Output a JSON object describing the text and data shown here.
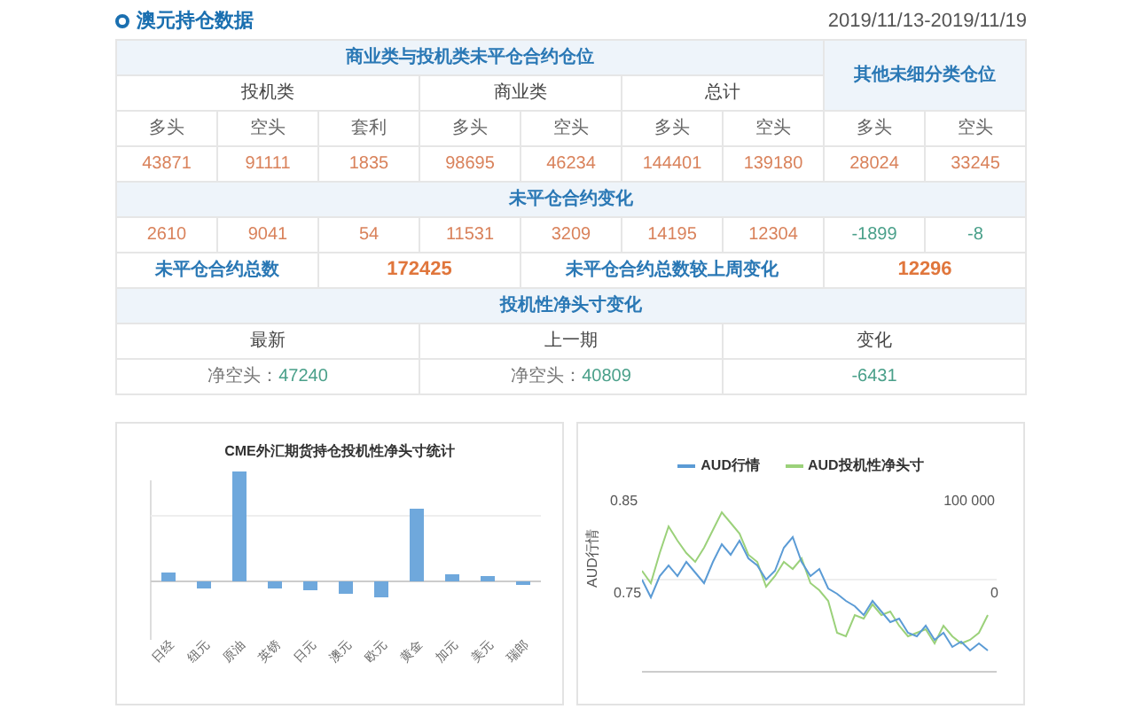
{
  "title": "澳元持仓数据",
  "date_range": "2019/11/13-2019/11/19",
  "table": {
    "group_header": "商业类与投机类未平仓合约仓位",
    "other_header": "其他未细分类仓位",
    "subgroups": [
      "投机类",
      "商业类",
      "总计"
    ],
    "position_headers": [
      "多头",
      "空头",
      "套利",
      "多头",
      "空头",
      "多头",
      "空头",
      "多头",
      "空头"
    ],
    "positions": [
      "43871",
      "91111",
      "1835",
      "98695",
      "46234",
      "144401",
      "139180",
      "28024",
      "33245"
    ],
    "change_header": "未平仓合约变化",
    "changes": [
      {
        "value": "2610",
        "color": "#d9825b"
      },
      {
        "value": "9041",
        "color": "#d9825b"
      },
      {
        "value": "54",
        "color": "#d9825b"
      },
      {
        "value": "11531",
        "color": "#d9825b"
      },
      {
        "value": "3209",
        "color": "#d9825b"
      },
      {
        "value": "14195",
        "color": "#d9825b"
      },
      {
        "value": "12304",
        "color": "#d9825b"
      },
      {
        "value": "-1899",
        "color": "#4aa08a"
      },
      {
        "value": "-8",
        "color": "#4aa08a"
      }
    ],
    "total_label": "未平仓合约总数",
    "total_value": "172425",
    "total_change_label": "未平仓合约总数较上周变化",
    "total_change_value": "12296",
    "net_header": "投机性净头寸变化",
    "net_columns": [
      "最新",
      "上一期",
      "变化"
    ],
    "net_values": [
      {
        "label": "净空头：",
        "value": "47240"
      },
      {
        "label": "净空头：",
        "value": "40809"
      },
      {
        "value": "-6431"
      }
    ]
  },
  "bar_chart": {
    "title": "CME外汇期货持仓投机性净头寸统计",
    "categories": [
      "日经",
      "纽元",
      "原油",
      "英镑",
      "日元",
      "澳元",
      "欧元",
      "黄金",
      "加元",
      "美元",
      "瑞郎"
    ]
  },
  "line_chart": {
    "legend": [
      {
        "name": "AUD行情",
        "color": "#5b9bd5"
      },
      {
        "name": "AUD投机性净头寸",
        "color": "#9bd17a"
      }
    ],
    "ylabel": "AUD行情",
    "left_ticks": [
      "0.85",
      "0.75"
    ],
    "right_ticks": [
      "100 000",
      "0"
    ]
  }
}
